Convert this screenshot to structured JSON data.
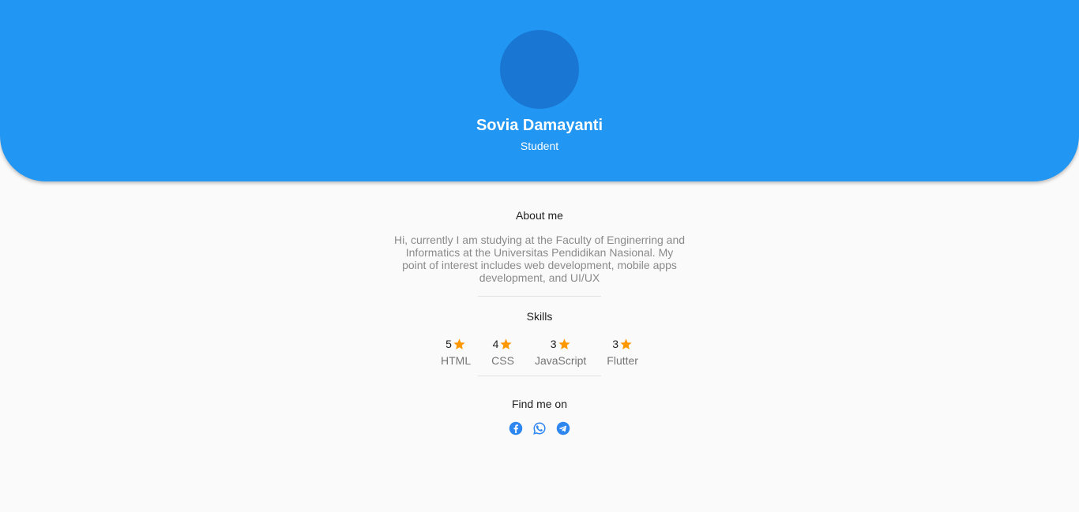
{
  "profile": {
    "name": "Sovia Damayanti",
    "role": "Student"
  },
  "about": {
    "title": "About me",
    "text": "Hi, currently I am studying at the Faculty of Enginerring and Informatics at the Universitas Pendidikan Nasional. My point of interest includes web development, mobile apps development, and UI/UX"
  },
  "skills": {
    "title": "Skills",
    "items": [
      {
        "rating": "5",
        "label": "HTML"
      },
      {
        "rating": "4",
        "label": "CSS"
      },
      {
        "rating": "3",
        "label": "JavaScript"
      },
      {
        "rating": "3",
        "label": "Flutter"
      }
    ]
  },
  "social": {
    "title": "Find me on",
    "icons": [
      "facebook-icon",
      "whatsapp-icon",
      "telegram-icon"
    ]
  },
  "colors": {
    "header": "#2196f3",
    "avatar": "#1976d2",
    "star": "#ff9800",
    "social": "#2e86f0"
  }
}
